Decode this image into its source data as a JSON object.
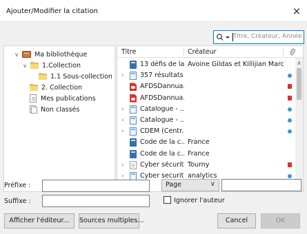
{
  "window": {
    "title": "Ajouter/Modifier la citation",
    "close_glyph": "×"
  },
  "search": {
    "placeholder": "Titre, Créateur, Année",
    "icon": "search-icon"
  },
  "collections": [
    {
      "label": "Ma bibliothèque",
      "level": 0,
      "expanded": true,
      "icon": "library-icon"
    },
    {
      "label": "1.Collection",
      "level": 1,
      "expanded": true,
      "icon": "folder-icon"
    },
    {
      "label": "1.1 Sous-collection",
      "level": 2,
      "expanded": false,
      "icon": "folder-icon"
    },
    {
      "label": "2. Collection",
      "level": 1,
      "expanded": false,
      "icon": "folder-icon"
    },
    {
      "label": "Mes publications",
      "level": 1,
      "expanded": false,
      "icon": "document-icon"
    },
    {
      "label": "Non classés",
      "level": 1,
      "expanded": false,
      "icon": "unfiled-icon"
    }
  ],
  "items_table": {
    "columns": {
      "title": "Titre",
      "creator": "Créateur",
      "attachment_icon": "paperclip-icon"
    },
    "rows": [
      {
        "title": "13 défis de la...",
        "creator": "Avoine Gildas et Killijian Marc-...",
        "icon": "book",
        "twisty": false,
        "attachment": "none"
      },
      {
        "title": "357 résultats ...",
        "creator": "",
        "icon": "web",
        "twisty": true,
        "attachment": "dot"
      },
      {
        "title": "AFDSDannua...",
        "creator": "",
        "icon": "pdf",
        "twisty": false,
        "attachment": "pdf"
      },
      {
        "title": "AFDSDannua...",
        "creator": "",
        "icon": "pdf",
        "twisty": false,
        "attachment": "pdf"
      },
      {
        "title": "Catalogue - ...",
        "creator": "",
        "icon": "web",
        "twisty": true,
        "attachment": "dot"
      },
      {
        "title": "Catalogue - ...",
        "creator": "",
        "icon": "web",
        "twisty": true,
        "attachment": "dot"
      },
      {
        "title": "CDEM (Centr...",
        "creator": "",
        "icon": "web",
        "twisty": true,
        "attachment": "dot"
      },
      {
        "title": "Code de la c...",
        "creator": "France",
        "icon": "book",
        "twisty": false,
        "attachment": "none"
      },
      {
        "title": "Code de la c...",
        "creator": "France",
        "icon": "book",
        "twisty": false,
        "attachment": "none"
      },
      {
        "title": "Cyber sécurit...",
        "creator": "Tourny",
        "icon": "doc",
        "twisty": true,
        "attachment": "pdf"
      },
      {
        "title": "Cyber securit...",
        "creator": "analytics",
        "icon": "web",
        "twisty": true,
        "attachment": "dot"
      }
    ]
  },
  "form": {
    "prefix_label": "Préfixe :",
    "prefix_value": "",
    "suffix_label": "Suffixe :",
    "suffix_value": "",
    "locator_select": "Page",
    "locator_value": "",
    "ignore_author_label": "Ignorer l'auteur",
    "ignore_author_checked": false
  },
  "buttons": {
    "show_editor": "Afficher l'éditeur...",
    "multiple_sources": "Sources multiples...",
    "cancel": "Cancel",
    "ok": "OK"
  }
}
